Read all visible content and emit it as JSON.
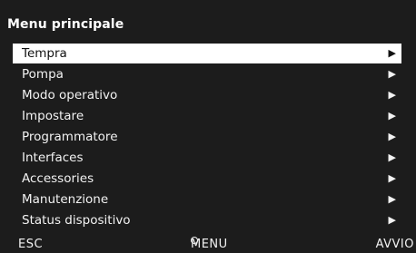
{
  "header": {
    "title": "Menu principale"
  },
  "menu": {
    "selected_index": 0,
    "arrow_glyph": "▶",
    "items": [
      {
        "label": "Tempra"
      },
      {
        "label": "Pompa"
      },
      {
        "label": "Modo operativo"
      },
      {
        "label": "Impostare"
      },
      {
        "label": "Programmatore"
      },
      {
        "label": "Interfaces"
      },
      {
        "label": "Accessories"
      },
      {
        "label": "Manutenzione"
      },
      {
        "label": "Status dispositivo"
      }
    ]
  },
  "footer": {
    "esc_label": "ESC",
    "menu_label": "MENU",
    "menu_icon": "circle-icon",
    "start_label": "AVVIO"
  },
  "colors": {
    "background": "#1c1c1c",
    "text": "#f2f2f2",
    "highlight_bg": "#ffffff",
    "highlight_text": "#111111"
  }
}
